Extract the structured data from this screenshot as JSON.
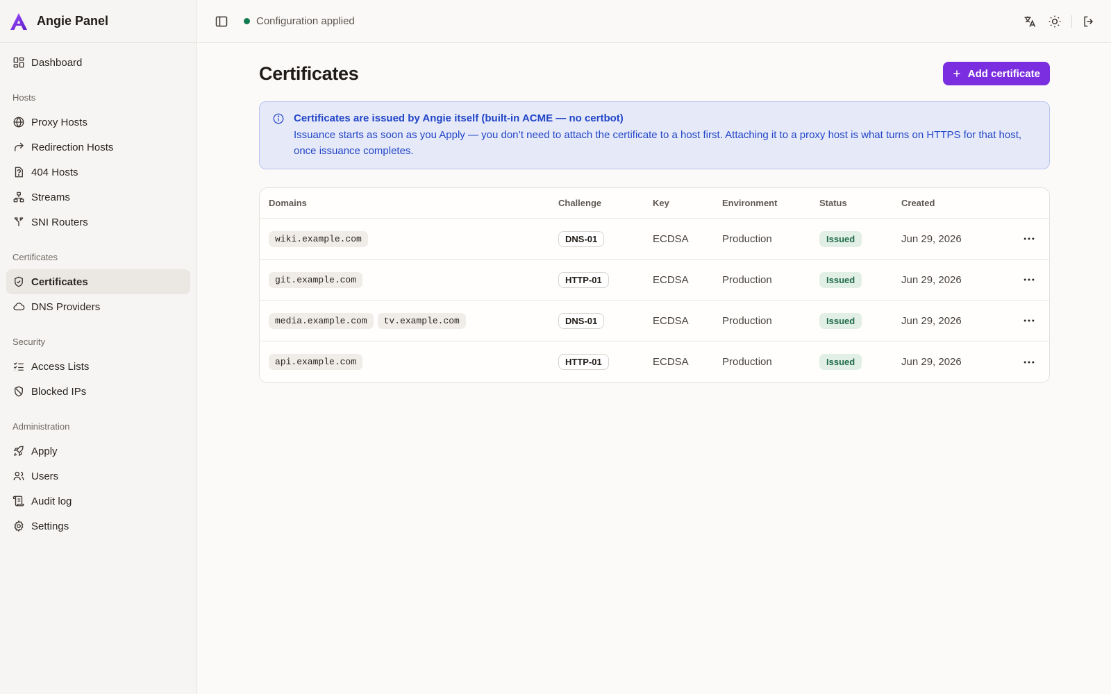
{
  "brand": {
    "name": "Angie Panel"
  },
  "topbar": {
    "status_text": "Configuration applied",
    "status_color": "#117a4f"
  },
  "sidebar": {
    "top_items": [
      {
        "label": "Dashboard"
      }
    ],
    "sections": [
      {
        "title": "Hosts",
        "items": [
          {
            "label": "Proxy Hosts"
          },
          {
            "label": "Redirection Hosts"
          },
          {
            "label": "404 Hosts"
          },
          {
            "label": "Streams"
          },
          {
            "label": "SNI Routers"
          }
        ]
      },
      {
        "title": "Certificates",
        "items": [
          {
            "label": "Certificates",
            "active": true
          },
          {
            "label": "DNS Providers"
          }
        ]
      },
      {
        "title": "Security",
        "items": [
          {
            "label": "Access Lists"
          },
          {
            "label": "Blocked IPs"
          }
        ]
      },
      {
        "title": "Administration",
        "items": [
          {
            "label": "Apply"
          },
          {
            "label": "Users"
          },
          {
            "label": "Audit log"
          },
          {
            "label": "Settings"
          }
        ]
      }
    ]
  },
  "page": {
    "title": "Certificates",
    "add_button_label": "Add certificate",
    "accent_color": "#7a2ee0"
  },
  "alert": {
    "title": "Certificates are issued by Angie itself (built-in ACME — no certbot)",
    "body": "Issuance starts as soon as you Apply — you don’t need to attach the certificate to a host first. Attaching it to a proxy host is what turns on HTTPS for that host, once issuance completes."
  },
  "table": {
    "columns": [
      "Domains",
      "Challenge",
      "Key",
      "Environment",
      "Status",
      "Created"
    ],
    "rows": [
      {
        "domains": [
          "wiki.example.com"
        ],
        "challenge": "DNS-01",
        "key": "ECDSA",
        "environment": "Production",
        "status": "Issued",
        "created": "Jun 29, 2026"
      },
      {
        "domains": [
          "git.example.com"
        ],
        "challenge": "HTTP-01",
        "key": "ECDSA",
        "environment": "Production",
        "status": "Issued",
        "created": "Jun 29, 2026"
      },
      {
        "domains": [
          "media.example.com",
          "tv.example.com"
        ],
        "challenge": "DNS-01",
        "key": "ECDSA",
        "environment": "Production",
        "status": "Issued",
        "created": "Jun 29, 2026"
      },
      {
        "domains": [
          "api.example.com"
        ],
        "challenge": "HTTP-01",
        "key": "ECDSA",
        "environment": "Production",
        "status": "Issued",
        "created": "Jun 29, 2026"
      }
    ]
  },
  "icons": {
    "brand": "angie-logo-icon",
    "sidebar_toggle": "sidebar-toggle-icon",
    "language": "translate-icon",
    "theme": "sun-icon",
    "logout": "logout-icon",
    "info": "info-icon",
    "row_menu": "more-horizontal-icon"
  }
}
